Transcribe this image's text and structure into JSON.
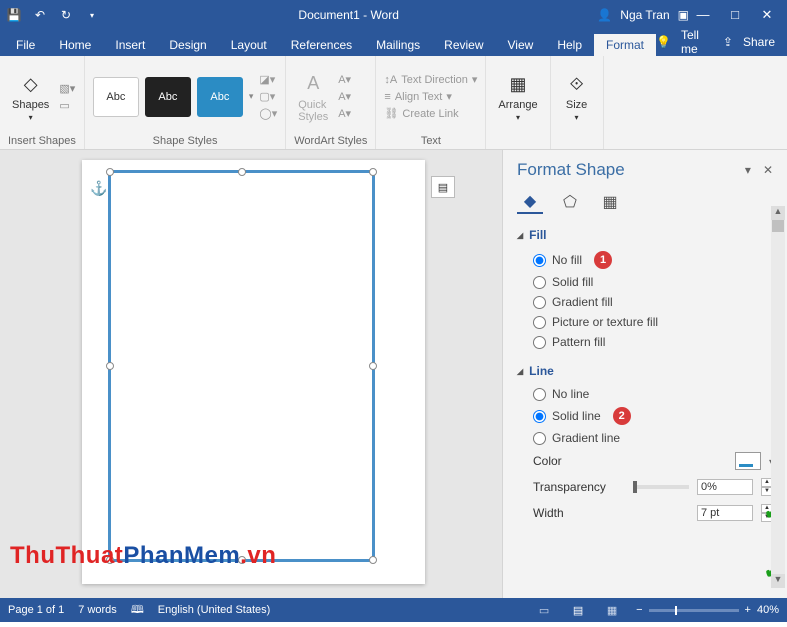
{
  "titlebar": {
    "doc_title": "Document1 - Word",
    "user_name": "Nga Tran"
  },
  "tabs": {
    "file": "File",
    "home": "Home",
    "insert": "Insert",
    "design": "Design",
    "layout": "Layout",
    "references": "References",
    "mailings": "Mailings",
    "review": "Review",
    "view": "View",
    "help": "Help",
    "format": "Format",
    "tellme": "Tell me",
    "share": "Share"
  },
  "ribbon": {
    "insert_shapes": {
      "label": "Insert Shapes",
      "shapes_btn": "Shapes"
    },
    "shape_styles": {
      "label": "Shape Styles",
      "sample_text": "Abc"
    },
    "wordart_styles": {
      "label": "WordArt Styles",
      "quick_styles": "Quick\nStyles"
    },
    "text": {
      "label": "Text",
      "direction": "Text Direction",
      "align": "Align Text",
      "link": "Create Link"
    },
    "arrange": {
      "label": "Arrange"
    },
    "size": {
      "label": "Size"
    }
  },
  "pane": {
    "title": "Format Shape",
    "fill": {
      "section": "Fill",
      "no_fill": "No fill",
      "solid_fill": "Solid fill",
      "gradient_fill": "Gradient fill",
      "picture_fill": "Picture or texture fill",
      "pattern_fill": "Pattern fill"
    },
    "line": {
      "section": "Line",
      "no_line": "No line",
      "solid_line": "Solid line",
      "gradient_line": "Gradient line",
      "color": "Color",
      "transparency": "Transparency",
      "transparency_val": "0%",
      "width": "Width",
      "width_val": "7 pt"
    },
    "callouts": {
      "one": "1",
      "two": "2"
    }
  },
  "statusbar": {
    "page": "Page 1 of 1",
    "words": "7 words",
    "lang": "English (United States)",
    "zoom": "40%"
  },
  "watermark": {
    "a": "ThuThuat",
    "b": "PhanMem",
    "c": ".vn"
  }
}
